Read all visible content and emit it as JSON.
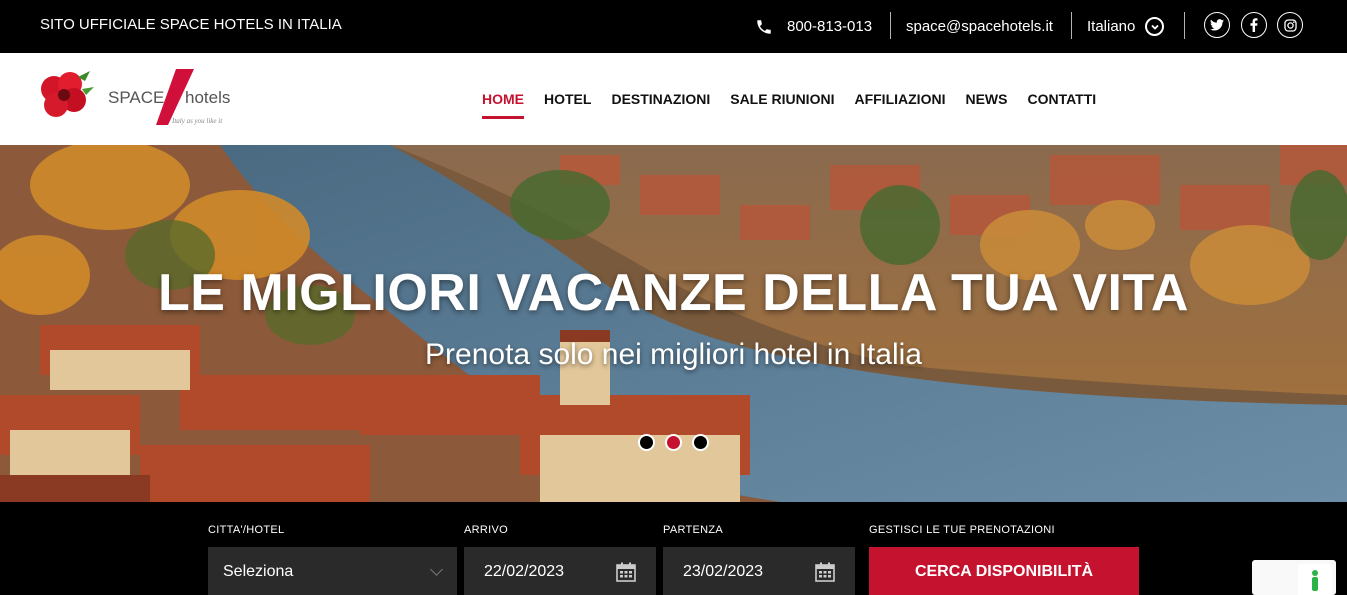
{
  "topbar": {
    "site_title": "SITO UFFICIALE SPACE HOTELS IN ITALIA",
    "phone": "800-813-013",
    "email": "space@spacehotels.it",
    "language": "Italiano",
    "social": [
      "twitter-icon",
      "facebook-icon",
      "instagram-icon"
    ]
  },
  "logo": {
    "brand_left": "SPACE",
    "brand_right": "hotels",
    "tagline": "Italy as you like it"
  },
  "nav": {
    "items": [
      {
        "label": "HOME",
        "active": true
      },
      {
        "label": "HOTEL"
      },
      {
        "label": "DESTINAZIONI"
      },
      {
        "label": "SALE RIUNIONI"
      },
      {
        "label": "AFFILIAZIONI"
      },
      {
        "label": "NEWS"
      },
      {
        "label": "CONTATTI"
      }
    ]
  },
  "hero": {
    "title": "LE MIGLIORI VACANZE DELLA TUA VITA",
    "subtitle": "Prenota solo nei migliori hotel in Italia",
    "slides": 3,
    "active_slide": 2
  },
  "booking": {
    "city_label": "CITTA'/HOTEL",
    "city_value": "Seleziona",
    "arrival_label": "ARRIVO",
    "arrival_value": "22/02/2023",
    "departure_label": "PARTENZA",
    "departure_value": "23/02/2023",
    "manage_label": "GESTISCI LE TUE PRENOTAZIONI",
    "search_label": "CERCA DISPONIBILITÀ"
  },
  "colors": {
    "accent": "#c4122f",
    "topbar_bg": "#000000",
    "field_bg": "#2a2a2a"
  }
}
